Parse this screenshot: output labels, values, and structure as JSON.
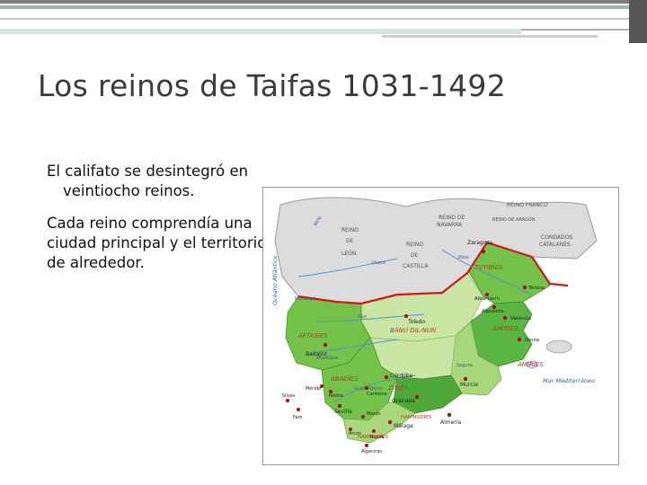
{
  "slide": {
    "title": "Los reinos de Taifas 1031-1492",
    "paragraph1_line1": "El califato se desintegró en",
    "paragraph1_line2": "veintiocho reinos.",
    "paragraph2": "Cada reino comprendía una ciudad principal y el territorio de alrededor."
  },
  "map": {
    "regions": {
      "reino_franco": "REINO FRANCO",
      "reino_navarra_1": "REINO DE",
      "reino_navarra_2": "NAVARRA",
      "reino_leon_1": "REINO",
      "reino_leon_2": "DE",
      "reino_leon_3": "LEÓN",
      "reino_castilla_1": "REINO",
      "reino_castilla_2": "DE",
      "reino_castilla_3": "CASTILLA",
      "reino_aragon": "REINO DE ARAGÓN",
      "condados_1": "CONDADOS",
      "condados_2": "CATALANES",
      "oceano": "Océano Atlántico",
      "mar": "Mar Mediterráneo",
      "banu_dil_nun": "BANU DIL-NUN",
      "aftasies": "AFTASÍES",
      "tuyibies": "TUYIBÍES",
      "amiries_1": "AMIRÍES",
      "amiries_2": "AMIRÍES",
      "abadies": "ABADÍES",
      "ziries": "ZIRÍES",
      "hammudies_1": "HAMMUDÍES",
      "hammudies_2": "HAMMUDÍES"
    },
    "rivers": {
      "mino": "Miño",
      "duero": "Duero",
      "ebro": "Ebro",
      "tajo": "Tajo",
      "mondego": "Mondego",
      "guadiana": "Guadiana",
      "guadalquivir": "Guadalquivir",
      "segura": "Segura"
    },
    "cities": {
      "zaragoza": "Zaragoza",
      "tortosa": "Tortosa",
      "albarracin": "Albarracín",
      "alpuente": "Alpuente",
      "valencia": "Valencia",
      "denia": "Denia",
      "toledo": "Toledo",
      "badajoz": "Badajoz",
      "merida": "Mérida",
      "niebla": "Niebla",
      "silves": "Silves",
      "faro": "Faro",
      "sevilla": "Sevilla",
      "carmona": "Carmona",
      "cordoba": "Córdoba",
      "granada": "Granada",
      "murcia": "Murcia",
      "almeria": "Almería",
      "malaga": "Málaga",
      "moron": "Morón",
      "arcos": "Arcos",
      "ronda": "Ronda",
      "algeciras": "Algeciras"
    }
  },
  "colors": {
    "christian": "#dcdcdc",
    "pale_green": "#c9e6a4",
    "light_green": "#a8d77c",
    "mid_green": "#74c24a",
    "dark_green": "#4fa83a",
    "border_red": "#d01818",
    "label_red": "#c0392b"
  }
}
